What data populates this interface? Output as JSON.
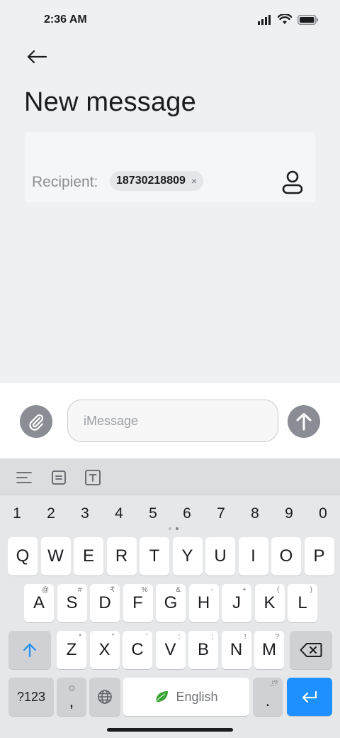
{
  "status_bar": {
    "time": "2:36 AM",
    "icons": [
      "signal-icon",
      "wifi-icon",
      "battery-icon"
    ]
  },
  "header": {
    "back_icon": "arrow-left-icon",
    "title": "New message"
  },
  "recipient": {
    "label": "Recipient:",
    "chips": [
      {
        "value": "18730218809",
        "remove_glyph": "×"
      }
    ],
    "contact_icon": "person-icon"
  },
  "compose": {
    "attach_icon": "paperclip-icon",
    "input_value": "",
    "placeholder": "iMessage",
    "send_icon": "arrow-up-icon"
  },
  "keyboard": {
    "toolbar_icons": [
      "menu-lines-icon",
      "clipboard-icon",
      "text-format-icon"
    ],
    "number_row": [
      "1",
      "2",
      "3",
      "4",
      "5",
      "6",
      "7",
      "8",
      "9",
      "0"
    ],
    "row1": [
      {
        "label": "Q"
      },
      {
        "label": "W"
      },
      {
        "label": "E"
      },
      {
        "label": "R"
      },
      {
        "label": "T"
      },
      {
        "label": "Y"
      },
      {
        "label": "U"
      },
      {
        "label": "I"
      },
      {
        "label": "O"
      },
      {
        "label": "P"
      }
    ],
    "row2": [
      {
        "label": "A",
        "hint": "@"
      },
      {
        "label": "S",
        "hint": "#"
      },
      {
        "label": "D",
        "hint": "₹"
      },
      {
        "label": "F",
        "hint": "%"
      },
      {
        "label": "G",
        "hint": "&"
      },
      {
        "label": "H",
        "hint": "-"
      },
      {
        "label": "J",
        "hint": "+"
      },
      {
        "label": "K",
        "hint": "("
      },
      {
        "label": "L",
        "hint": ")"
      }
    ],
    "row3": [
      {
        "label": "Z",
        "hint": "*"
      },
      {
        "label": "X",
        "hint": "\""
      },
      {
        "label": "C",
        "hint": "'"
      },
      {
        "label": "V",
        "hint": ":"
      },
      {
        "label": "B",
        "hint": ";"
      },
      {
        "label": "N",
        "hint": "!"
      },
      {
        "label": "M",
        "hint": "?"
      }
    ],
    "shift_icon": "shift-arrow-icon",
    "backspace_icon": "backspace-icon",
    "symbols_label": "?123",
    "comma_label": ",",
    "comma_hint": "☺",
    "globe_icon": "globe-icon",
    "space_label": "English",
    "space_icon": "leaf-icon",
    "period_label": ".",
    "period_hint": ",!?",
    "enter_icon": "enter-arrow-icon"
  },
  "colors": {
    "background": "#eef0f3",
    "action_button": "#8a8d93",
    "enter_key": "#1e90ff",
    "shift_arrow": "#1e90ff",
    "leaf": "#3aa335"
  }
}
